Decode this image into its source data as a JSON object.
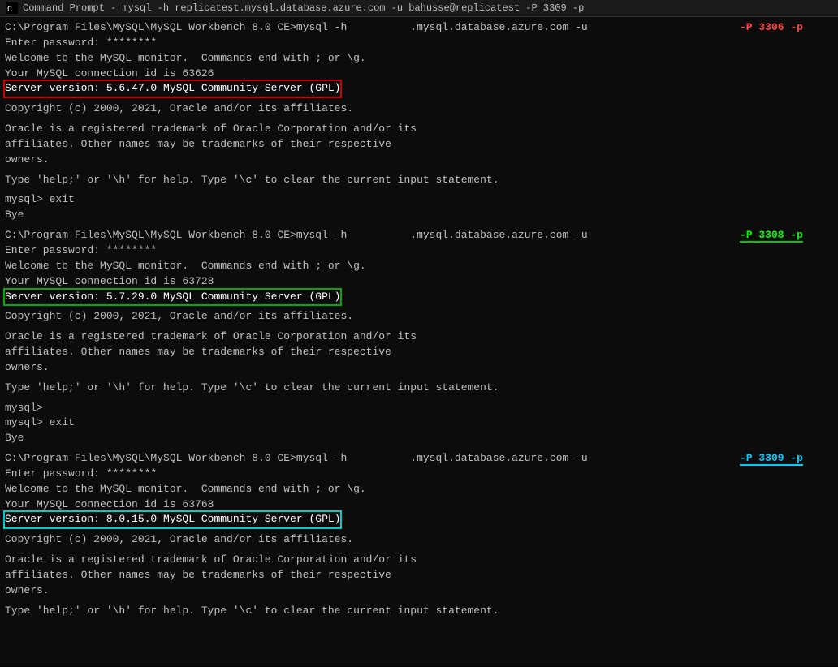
{
  "titleBar": {
    "icon": "cmd-icon",
    "label": "Command Prompt - mysql -h replicatest.mysql.database.azure.com -u bahusse@replicatest -P 3309 -p"
  },
  "sections": [
    {
      "id": "section1",
      "connectLine": "C:\\Program Files\\MySQL\\MySQL Workbench 8.0 CE>mysql -h          .mysql.database.azure.com -u                        -P 3306 -p",
      "passwordLine": "Enter password: ********",
      "welcomeLine1": "Welcome to the MySQL monitor.  Commands end with ; or \\g.",
      "welcomeLine2": "Your MySQL connection id is 63626",
      "serverVersion": "Server version: 5.6.47.0 MySQL Community Server (GPL)",
      "versionStyle": "red",
      "copyright1": "Copyright (c) 2000, 2021, Oracle and/or its affiliates.",
      "oracle1": "Oracle is a registered trademark of Oracle Corporation and/or its",
      "oracle2": "affiliates. Other names may be trademarks of their respective",
      "oracle3": "owners.",
      "helpLine": "Type 'help;' or '\\h' for help. Type '\\c' to clear the current input statement.",
      "exitPrompt": "mysql> exit",
      "bye": "Bye",
      "portLabel": "-P 3306 -p",
      "portStyle": "red"
    },
    {
      "id": "section2",
      "connectLine": "C:\\Program Files\\MySQL\\MySQL Workbench 8.0 CE>mysql -h          .mysql.database.azure.com -u                        -P 3308 -p",
      "passwordLine": "Enter password: ********",
      "welcomeLine1": "Welcome to the MySQL monitor.  Commands end with ; or \\g.",
      "welcomeLine2": "Your MySQL connection id is 63728",
      "serverVersion": "Server version: 5.7.29.0 MySQL Community Server (GPL)",
      "versionStyle": "green",
      "copyright1": "Copyright (c) 2000, 2021, Oracle and/or its affiliates.",
      "oracle1": "Oracle is a registered trademark of Oracle Corporation and/or its",
      "oracle2": "affiliates. Other names may be trademarks of their respective",
      "oracle3": "owners.",
      "helpLine": "Type 'help;' or '\\h' for help. Type '\\c' to clear the current input statement.",
      "exitPrompt1": "mysql>",
      "exitPrompt2": "mysql> exit",
      "bye": "Bye",
      "portLabel": "-P 3308 -p",
      "portStyle": "green"
    },
    {
      "id": "section3",
      "connectLine": "C:\\Program Files\\MySQL\\MySQL Workbench 8.0 CE>mysql -h          .mysql.database.azure.com -u                        -P 3309 -p",
      "passwordLine": "Enter password: ********",
      "welcomeLine1": "Welcome to the MySQL monitor.  Commands end with ; or \\g.",
      "welcomeLine2": "Your MySQL connection id is 63768",
      "serverVersion": "Server version: 8.0.15.0 MySQL Community Server (GPL)",
      "versionStyle": "cyan",
      "copyright1": "Copyright (c) 2000, 2021, Oracle and/or its affiliates.",
      "oracle1": "Oracle is a registered trademark of Oracle Corporation and/or its",
      "oracle2": "affiliates. Other names may be trademarks of their respective",
      "oracle3": "owners.",
      "helpLine": "Type 'help;' or '\\h' for help. Type '\\c' to clear the current input statement.",
      "portLabel": "-P 3309 -p",
      "portStyle": "cyan"
    }
  ]
}
